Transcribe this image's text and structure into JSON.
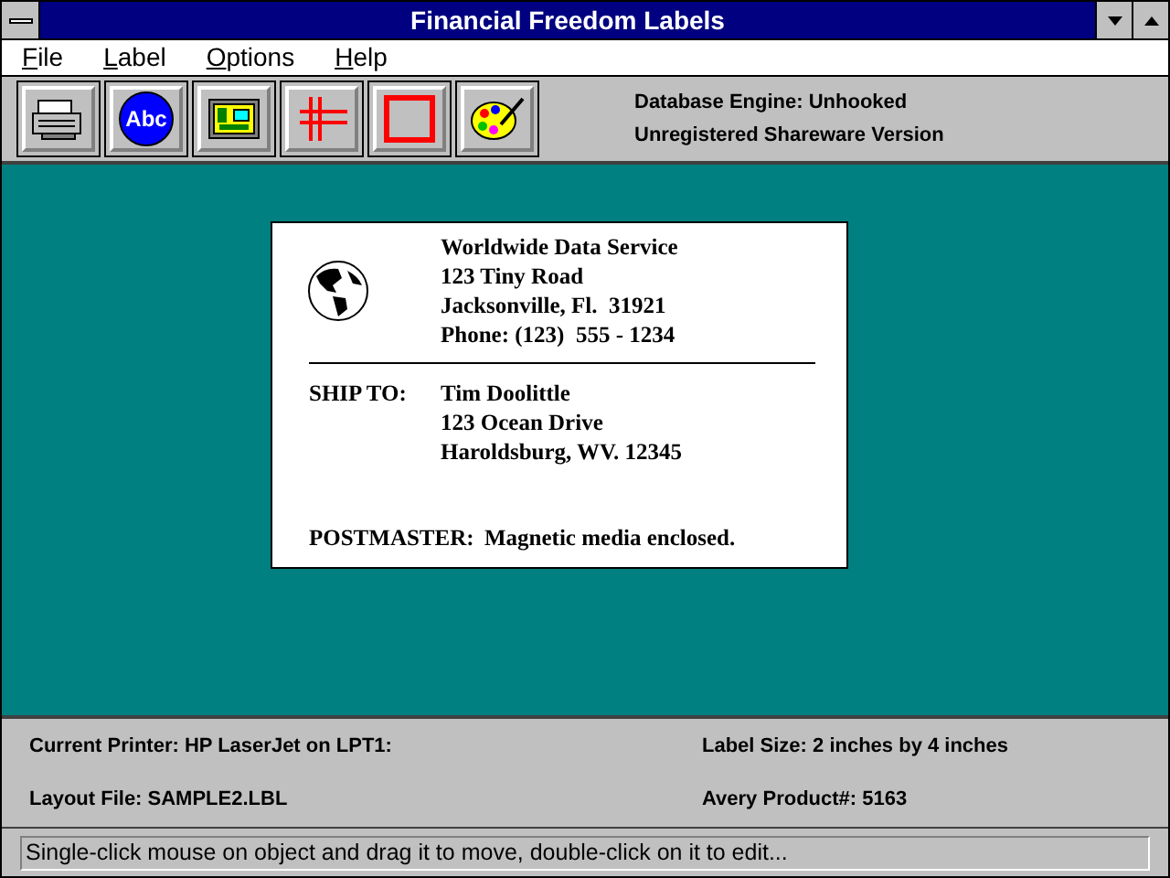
{
  "window": {
    "title": "Financial Freedom Labels"
  },
  "menu": [
    "File",
    "Label",
    "Options",
    "Help"
  ],
  "toolbar": [
    {
      "kind": "printer"
    },
    {
      "kind": "text",
      "label": "Abc"
    },
    {
      "kind": "picture"
    },
    {
      "kind": "lines"
    },
    {
      "kind": "box"
    },
    {
      "kind": "palette"
    }
  ],
  "toolbar_info": [
    "Database Engine: Unhooked",
    "Unregistered Shareware Version"
  ],
  "label": {
    "sender": [
      "Worldwide Data Service",
      "123 Tiny Road",
      "Jacksonville, Fl.  31921",
      "Phone: (123)  555 - 1234"
    ],
    "ship_to_caption": "SHIP TO:",
    "recipient": [
      "Tim Doolittle",
      "123 Ocean Drive",
      "Haroldsburg, WV. 12345"
    ],
    "postmaster_caption": "POSTMASTER:",
    "postmaster_note": "Magnetic media enclosed."
  },
  "info": {
    "printer": "Current Printer: HP LaserJet on LPT1:",
    "label_size": "Label Size: 2 inches by 4 inches",
    "layout_file": "Layout File: SAMPLE2.LBL",
    "avery_product": "Avery Product#: 5163"
  },
  "status_bar": "Single-click mouse on object and drag it to move, double-click on it to edit..."
}
